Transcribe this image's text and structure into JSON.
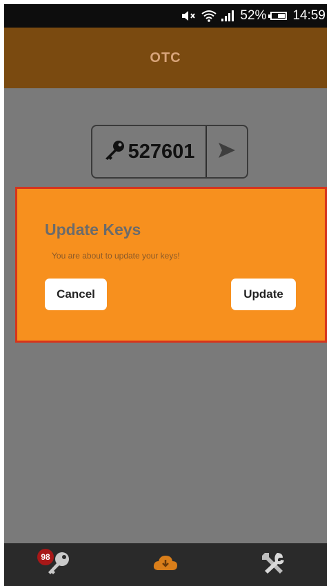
{
  "status_bar": {
    "battery": "52%",
    "time": "14:59",
    "icons": [
      "volume-muted-icon",
      "wifi-icon",
      "signal-icon",
      "battery-icon"
    ]
  },
  "header": {
    "title": "OTC"
  },
  "code": {
    "value": "527601",
    "icon": "key-icon",
    "action_icon": "send-arrow-icon"
  },
  "dialog": {
    "title": "Update Keys",
    "message": "You are about to update your keys!",
    "cancel_label": "Cancel",
    "update_label": "Update"
  },
  "bottom_nav": {
    "keys_badge": "98",
    "items": [
      "keys-icon",
      "cloud-download-icon",
      "tools-icon"
    ]
  },
  "colors": {
    "header": "#7a4a10",
    "header_title": "#d8a47a",
    "dialog_bg": "#f7901e",
    "dialog_border": "#d6341c",
    "background": "#7a7a7a",
    "nav_bg": "#2a2a2a",
    "accent": "#d97e1a"
  }
}
